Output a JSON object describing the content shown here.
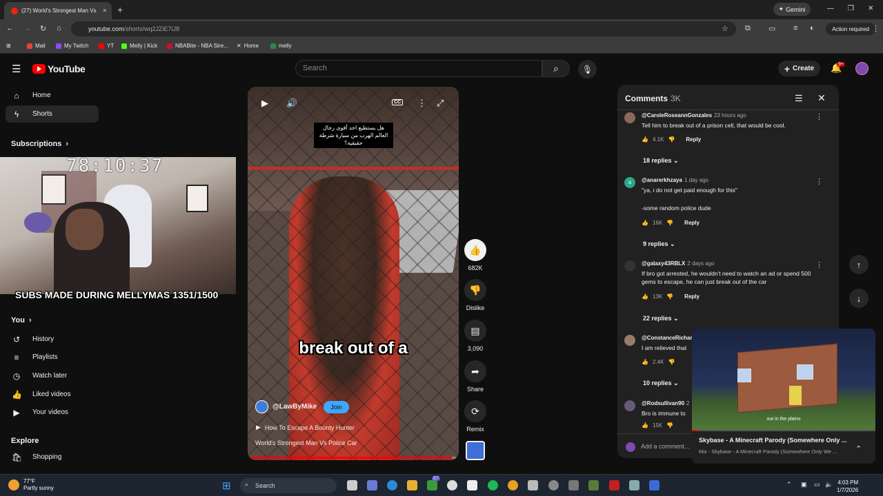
{
  "browser": {
    "tab_title": "(27) World's Strongest Man Vs",
    "new_tab": "+",
    "gemini": "Gemini",
    "url_domain": "youtube.com",
    "url_path": "/shorts/wq2JZiE7iJ8",
    "action_required": "Action required",
    "bookmarks": [
      "Mail",
      "My Twitch",
      "YT",
      "Melly | Kick",
      "NBABite - NBA Stre...",
      "Home",
      "melly"
    ]
  },
  "youtube": {
    "logo": "YouTube",
    "search_placeholder": "Search",
    "create": "Create",
    "notif_count": "9+"
  },
  "sidebar": {
    "items_top": [
      "Home",
      "Shorts"
    ],
    "subscriptions": "Subscriptions",
    "you": "You",
    "items_you": [
      "History",
      "Playlists",
      "Watch later",
      "Liked videos",
      "Your videos"
    ],
    "explore": "Explore",
    "items_explore": [
      "Shopping"
    ]
  },
  "overlay": {
    "timer": "78:10:37",
    "subs_text": "SUBS MADE DURING MELLYMAS 1351/1500"
  },
  "short": {
    "arabic_caption": "هل يستطيع احد أقوى رجال العالم الهرب من سيارة شرطة حقيقية؟",
    "caption": "break out of a",
    "cc": "CC",
    "channel": "@LawByMike",
    "join": "Join",
    "link": "How To Escape A Bounty Hunter",
    "title": "World's Strongest Man Vs Police Car",
    "progress": 0.98
  },
  "actions": {
    "likes": "682K",
    "dislike": "Dislike",
    "comments": "3,090",
    "share": "Share",
    "remix": "Remix"
  },
  "comments": {
    "title": "Comments",
    "count": "3K",
    "reply": "Reply",
    "add_placeholder": "Add a comment...",
    "items": [
      {
        "author": "@CaroleRoseannGonzales",
        "time": "23 hours ago",
        "text": "Tell him to break out of a prison cell, that would be cool.",
        "likes": "4.1K",
        "replies": "18 replies",
        "avatar_color": "#8a6a5a"
      },
      {
        "author": "@anarerkhzaya",
        "time": "1 day ago",
        "text": "\"ya, i do not get paid enough for this\"",
        "text2": "-some random police dude",
        "likes": "16K",
        "replies": "9 replies",
        "avatar_color": "#2aa88a",
        "avatar_letter": "a"
      },
      {
        "author": "@galaxy43RBLX",
        "time": "2 days ago",
        "text": "If bro got arrested, he wouldn't need to watch an ad or spend 500 gems to escape, he can just break out of the car",
        "likes": "13K",
        "replies": "22 replies",
        "avatar_color": "#333333"
      },
      {
        "author": "@ConstanceRichar",
        "time": "",
        "text": "I am relieved that",
        "likes": "2.4K",
        "replies": "10 replies",
        "avatar_color": "#9a7a6a"
      },
      {
        "author": "@Rodsullivan90",
        "time": "2",
        "text": "Bro is immune to",
        "likes": "15K",
        "replies": "",
        "avatar_color": "#6a5a7a"
      }
    ]
  },
  "miniplayer": {
    "subtitle": "out in the plains",
    "title": "Skybase - A Minecraft Parody (Somewhere Only ...",
    "mix": "Mix - Skybase - A Minecraft Parody (Somewhere Only We ...",
    "progress": 0.03
  },
  "taskbar": {
    "temp": "77°F",
    "weather": "Partly sunny",
    "search": "Search",
    "time": "4:03 PM",
    "date": "1/7/2026",
    "badge": "27"
  }
}
